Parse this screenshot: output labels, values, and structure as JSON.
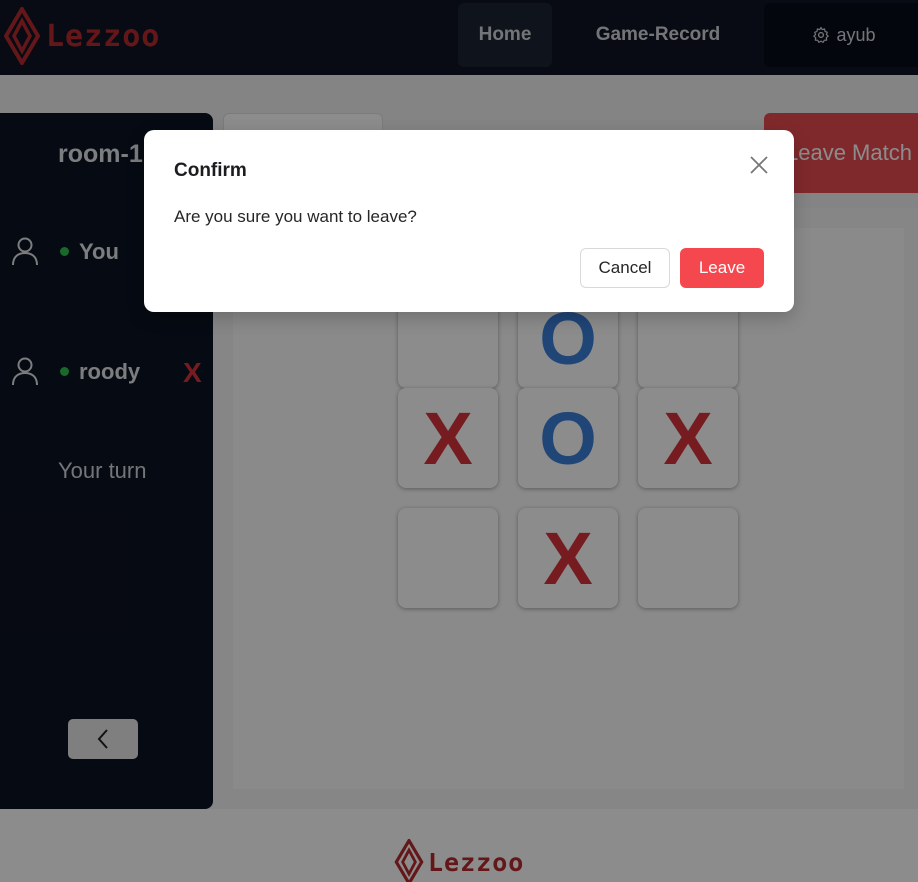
{
  "navbar": {
    "logo_text": "Lezzoo",
    "home_label": "Home",
    "record_label": "Game-Record",
    "user_label": "ayub",
    "user_icon": "gear-icon"
  },
  "sidebar": {
    "room_title": "room-1",
    "players": [
      {
        "name": "You",
        "mark": "",
        "online": true
      },
      {
        "name": "roody",
        "mark": "X",
        "online": true
      }
    ],
    "turn_text": "Your turn",
    "back_icon": "chevron-left-icon"
  },
  "leave_match_label": "Leave Match",
  "board": {
    "cells": [
      "",
      "O",
      "",
      "X",
      "O",
      "X",
      "",
      "X",
      ""
    ]
  },
  "footer": {
    "logo_text": "Lezzoo"
  },
  "modal": {
    "title": "Confirm",
    "message": "Are you sure you want to leave?",
    "cancel_label": "Cancel",
    "leave_label": "Leave",
    "close_icon": "close-icon"
  },
  "colors": {
    "brand": "#b72a2e",
    "navbar_bg": "#0f1523",
    "danger": "#f5474e",
    "mark_x": "#d8343b",
    "mark_o": "#3b7ed9",
    "online": "#2fbf4e"
  }
}
